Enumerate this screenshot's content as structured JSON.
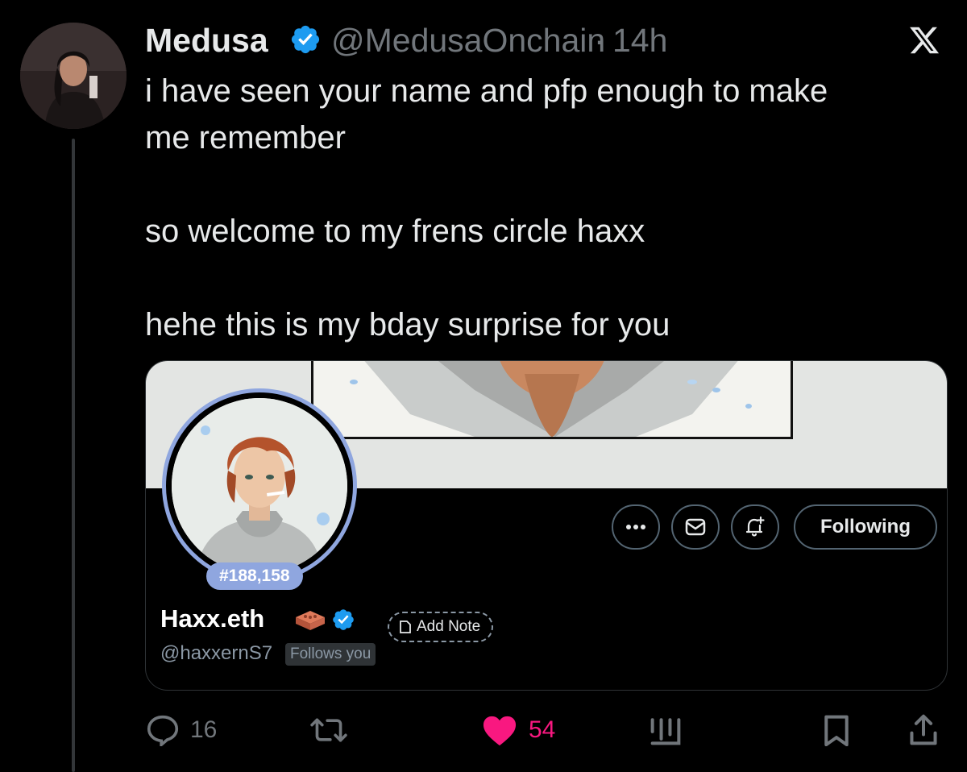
{
  "tweet": {
    "author_name": "Medusa",
    "author_handle": "@MedusaOnchain",
    "separator": "·",
    "time": "14h",
    "text_lines": [
      "i have seen your name and pfp enough to make",
      "me remember",
      "so welcome to my frens circle haxx",
      "hehe this is my bday surprise for you"
    ]
  },
  "profile_card": {
    "rank": "#188,158",
    "name": "Haxx.eth",
    "handle": "@haxxernS7",
    "follows_you": "Follows you",
    "add_note": "Add Note",
    "following_button": "Following"
  },
  "actions": {
    "replies": "16",
    "likes": "54"
  },
  "colors": {
    "background": "#000000",
    "text": "#e7e9ea",
    "muted": "#71767b",
    "verified": "#1d9bf0",
    "like": "#f91880",
    "rank_badge": "#8fa6df"
  },
  "icons": [
    "x-logo-icon",
    "verified-badge-icon",
    "more-icon",
    "message-icon",
    "notification-add-icon",
    "brick-icon",
    "note-icon",
    "reply-icon",
    "retweet-icon",
    "heart-icon",
    "views-icon",
    "bookmark-icon",
    "share-icon"
  ]
}
